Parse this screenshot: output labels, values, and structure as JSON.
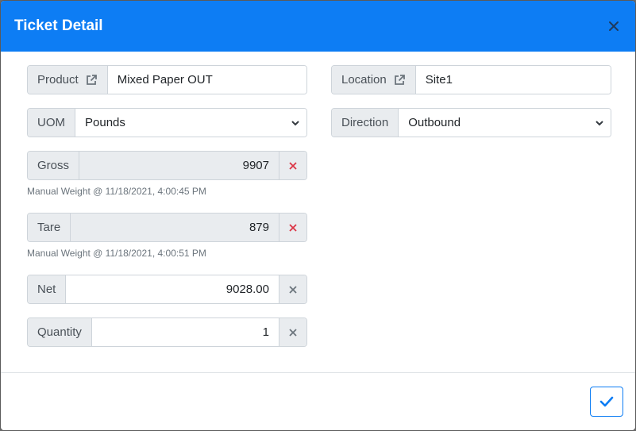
{
  "header": {
    "title": "Ticket Detail"
  },
  "product": {
    "label": "Product",
    "value": "Mixed Paper OUT"
  },
  "location": {
    "label": "Location",
    "value": "Site1"
  },
  "uom": {
    "label": "UOM",
    "value": "Pounds"
  },
  "direction": {
    "label": "Direction",
    "value": "Outbound"
  },
  "gross": {
    "label": "Gross",
    "value": "9907",
    "hint": "Manual Weight @ 11/18/2021, 4:00:45 PM"
  },
  "tare": {
    "label": "Tare",
    "value": "879",
    "hint": "Manual Weight @ 11/18/2021, 4:00:51 PM"
  },
  "net": {
    "label": "Net",
    "value": "9028.00"
  },
  "quantity": {
    "label": "Quantity",
    "value": "1"
  },
  "colors": {
    "header_bg": "#0d7df4",
    "clear_red": "#dc3545",
    "clear_gray": "#6c757d"
  },
  "icons": {
    "close": "close-icon",
    "external_link": "external-link-icon",
    "clear": "times-icon",
    "chevron": "chevron-down-icon",
    "confirm": "check-icon"
  }
}
